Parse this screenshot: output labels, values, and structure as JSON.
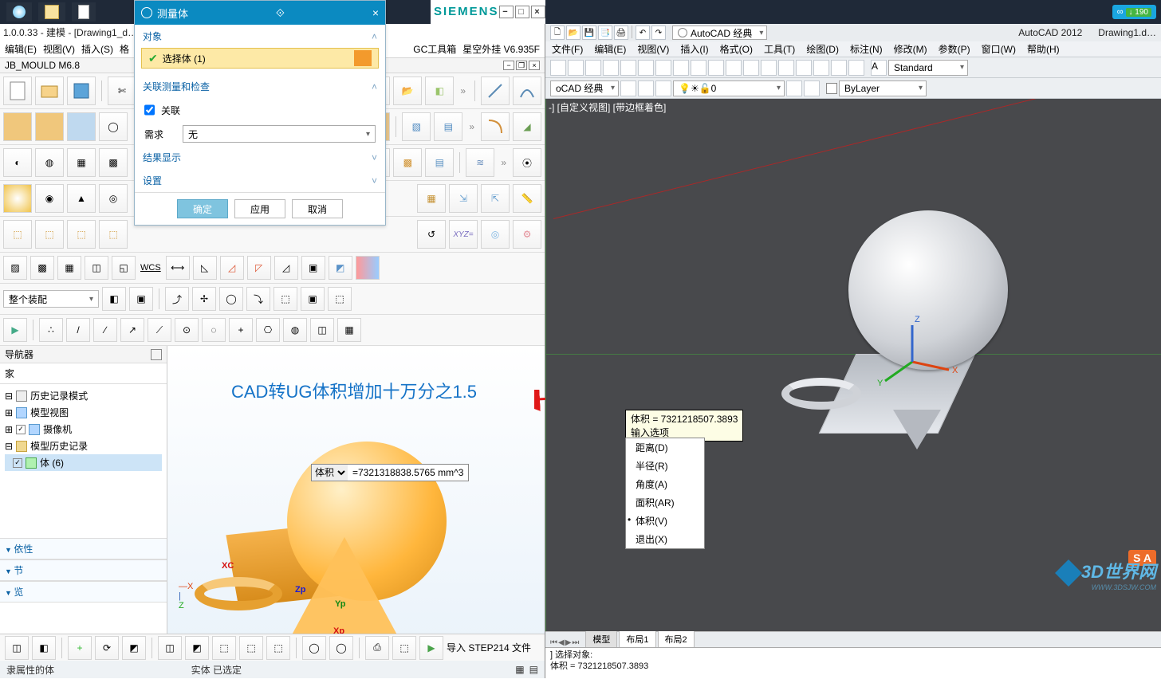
{
  "topbar": {
    "items": [
      "建模",
      "Drawing1",
      "",
      ""
    ],
    "sync_speed": "↓ 190"
  },
  "nx_title": "1.0.0.33 - 建模 - [Drawing1_d…",
  "nx_menus": [
    "编辑(E)",
    "视图(V)",
    "插入(S)",
    "格",
    "GC工具箱",
    "星空外挂 V6.935F"
  ],
  "nx_sub": "JB_MOULD M6.8",
  "siemens": "SIEMENS",
  "combo_assembly": "整个装配",
  "combo_wcs": "WCS",
  "import_step_label": "导入 STEP214 文件",
  "nav_title": "导航器",
  "nav_header": "家",
  "tree": {
    "history_mode": "历史记录模式",
    "model_view": "模型视图",
    "camera": "摄像机",
    "model_history": "模型历史记录",
    "body": "体 (6)"
  },
  "nav_sections": [
    "依性",
    "节",
    "览"
  ],
  "annotation": "CAD转UG体积增加十万分之1.5",
  "measure": {
    "label": "体积",
    "value": "=7321318838.5765 mm^3"
  },
  "status_left": "隶属性的体",
  "status_right": "实体 已选定",
  "dlg": {
    "title": "测量体",
    "object": "对象",
    "select": "选择体 (1)",
    "assoc_title": "关联测量和检查",
    "assoc_chk": "关联",
    "need_label": "需求",
    "need_value": "无",
    "result": "结果显示",
    "settings": "设置",
    "ok": "确定",
    "apply": "应用",
    "cancel": "取消"
  },
  "autocad": {
    "workspace": "AutoCAD 经典",
    "app": "AutoCAD 2012",
    "fname": "Drawing1.d…",
    "menus": [
      "文件(F)",
      "编辑(E)",
      "视图(V)",
      "插入(I)",
      "格式(O)",
      "工具(T)",
      "绘图(D)",
      "标注(N)",
      "修改(M)",
      "参数(P)",
      "窗口(W)",
      "帮助(H)"
    ],
    "toolbar2": {
      "layer0": "0",
      "color": "ByLayer",
      "style": "Standard",
      "ws": "oCAD 经典"
    },
    "view_label": "-] [自定义视图] [带边框着色]",
    "tooltip_vol": "体积 = 7321218507.3893",
    "tooltip_in": "输入选项",
    "menu_pop": [
      "距离(D)",
      "半径(R)",
      "角度(A)",
      "面积(AR)",
      "体积(V)",
      "退出(X)"
    ],
    "tabs": [
      "模型",
      "布局1",
      "布局2"
    ],
    "cmd": "] 选择对象:\n体积 = 7321218507.3893"
  },
  "watermark": "3D世界网",
  "watermark2": "WWW.3DSJW.COM",
  "badge": "S A",
  "axes": [
    "Xp",
    "Yp",
    "Zp",
    "XC"
  ],
  "cad_axes": [
    "X",
    "Y",
    "Z"
  ],
  "viewcube": [
    "X",
    "Y"
  ]
}
